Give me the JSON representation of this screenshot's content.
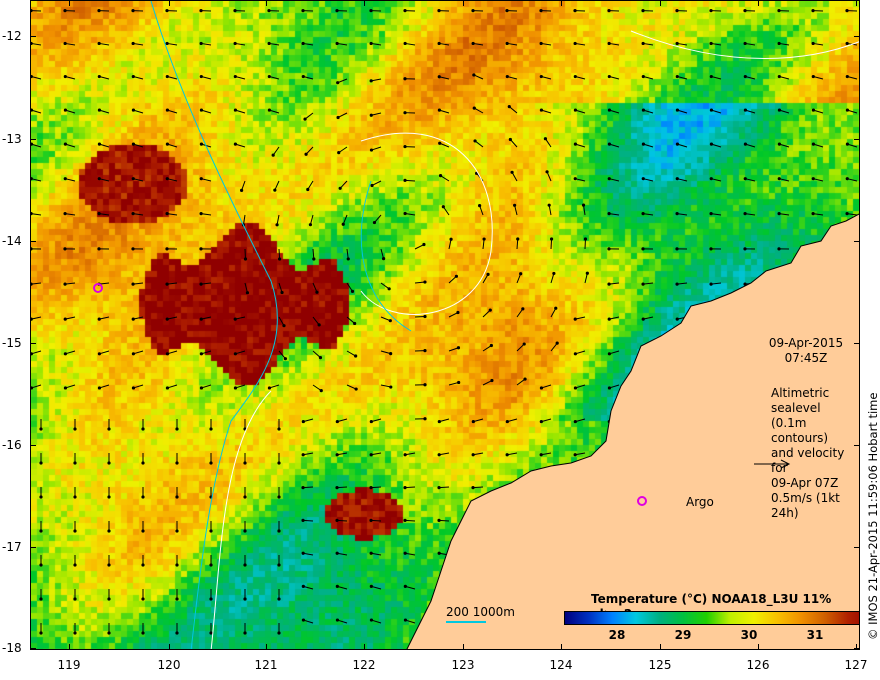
{
  "map": {
    "lat_labels": [
      "-12",
      "-13",
      "-14",
      "-15",
      "-16",
      "-17",
      "-18"
    ],
    "lon_labels": [
      "119",
      "120",
      "121",
      "122",
      "123",
      "124",
      "125",
      "126",
      "127"
    ],
    "date": "09-Apr-2015",
    "time": "07:45Z",
    "altimetry_note": [
      "Altimetric sealevel",
      "(0.1m contours)",
      "and velocity for",
      "09-Apr 07Z",
      "0.5m/s (1kt 24h)"
    ],
    "argo_label": "Argo",
    "scale_label": "200  1000m",
    "credit": "© IMOS 21-Apr-2015 11:59:06 Hobart time"
  },
  "colorbar": {
    "title": "Temperature (°C) NOAA18_L3U 11% ql>=2",
    "ticks": [
      "28",
      "29",
      "30",
      "31"
    ],
    "range": [
      27.2,
      31.8
    ]
  },
  "colors": {
    "land": "#ffcc99",
    "contour": "#ffffff",
    "bathymetry": "#00c8e0",
    "argo": "#e000e0"
  }
}
